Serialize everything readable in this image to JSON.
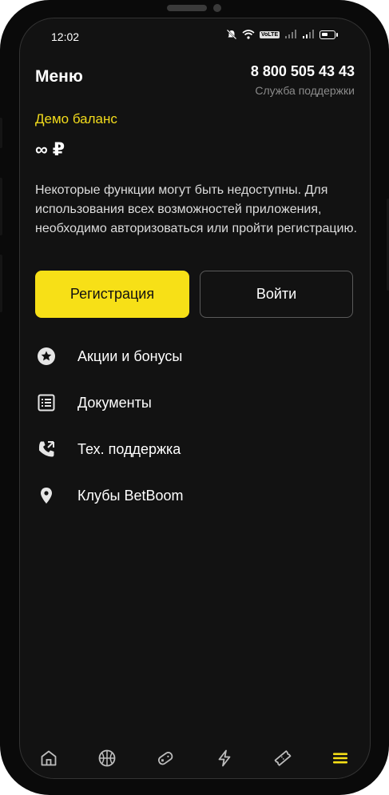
{
  "status_bar": {
    "time": "12:02",
    "network_badge": "VoLTE"
  },
  "header": {
    "title": "Меню",
    "support_phone": "8 800 505 43 43",
    "support_label": "Служба поддержки"
  },
  "balance": {
    "label": "Демо баланс",
    "value": "∞ ₽"
  },
  "notice": "Некоторые функции могут быть недоступны. Для использования всех возможностей приложения, необходимо авторизоваться или пройти регистрацию.",
  "buttons": {
    "register": "Регистрация",
    "login": "Войти"
  },
  "menu": {
    "items": [
      {
        "label": "Акции и бонусы",
        "icon": "star-badge-icon"
      },
      {
        "label": "Документы",
        "icon": "document-list-icon"
      },
      {
        "label": "Тех. поддержка",
        "icon": "phone-support-icon"
      },
      {
        "label": "Клубы BetBoom",
        "icon": "location-pin-icon"
      }
    ]
  },
  "tabbar": {
    "tabs": [
      {
        "icon": "home-icon",
        "active": false
      },
      {
        "icon": "basketball-icon",
        "active": false
      },
      {
        "icon": "gamepad-icon",
        "active": false
      },
      {
        "icon": "lightning-icon",
        "active": false
      },
      {
        "icon": "ticket-icon",
        "active": false
      },
      {
        "icon": "hamburger-menu-icon",
        "active": true
      }
    ]
  },
  "colors": {
    "accent": "#f7e017",
    "background": "#121212",
    "text": "#ffffff",
    "muted": "#8a8a8a"
  }
}
